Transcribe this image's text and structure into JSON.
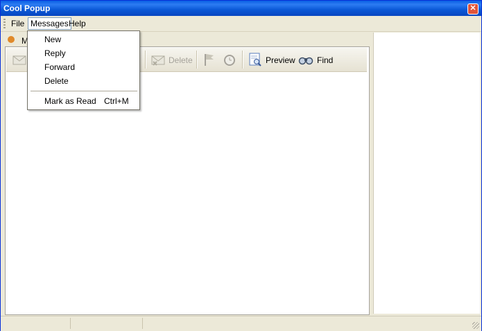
{
  "window": {
    "title": "Cool Popup",
    "close_glyph": "✕"
  },
  "menubar": {
    "items": [
      "File",
      "Messages",
      "Help"
    ]
  },
  "tab": {
    "label": "M"
  },
  "toolbar": {
    "delete_label": "Delete",
    "preview_label": "Preview",
    "find_label": "Find"
  },
  "messages_menu": {
    "items": [
      {
        "label": "New",
        "shortcut": ""
      },
      {
        "label": "Reply",
        "shortcut": ""
      },
      {
        "label": "Forward",
        "shortcut": ""
      },
      {
        "label": "Delete",
        "shortcut": ""
      },
      {
        "label": "Mark as Read",
        "shortcut": "Ctrl+M"
      }
    ]
  },
  "colors": {
    "titlebar": "#0a58d6",
    "menu_border": "#716f64",
    "accent": "#f0a030"
  }
}
